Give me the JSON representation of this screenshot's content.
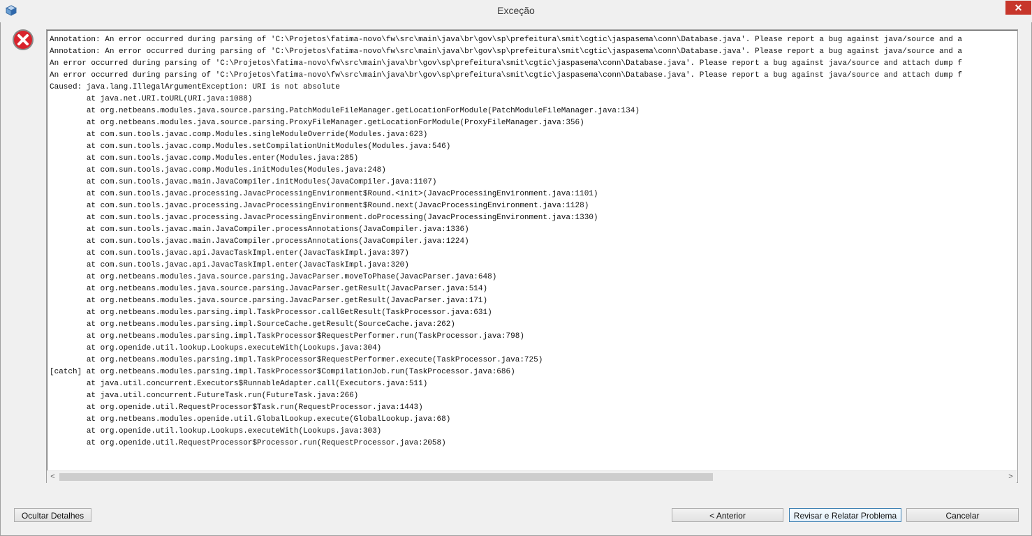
{
  "window": {
    "title": "Exceção",
    "close_label": "✕"
  },
  "trace_text": "Annotation: An error occurred during parsing of 'C:\\Projetos\\fatima-novo\\fw\\src\\main\\java\\br\\gov\\sp\\prefeitura\\smit\\cgtic\\jaspasema\\conn\\Database.java'. Please report a bug against java/source and a\nAnnotation: An error occurred during parsing of 'C:\\Projetos\\fatima-novo\\fw\\src\\main\\java\\br\\gov\\sp\\prefeitura\\smit\\cgtic\\jaspasema\\conn\\Database.java'. Please report a bug against java/source and a\nAn error occurred during parsing of 'C:\\Projetos\\fatima-novo\\fw\\src\\main\\java\\br\\gov\\sp\\prefeitura\\smit\\cgtic\\jaspasema\\conn\\Database.java'. Please report a bug against java/source and attach dump f\nAn error occurred during parsing of 'C:\\Projetos\\fatima-novo\\fw\\src\\main\\java\\br\\gov\\sp\\prefeitura\\smit\\cgtic\\jaspasema\\conn\\Database.java'. Please report a bug against java/source and attach dump f\nCaused: java.lang.IllegalArgumentException: URI is not absolute\n\tat java.net.URI.toURL(URI.java:1088)\n\tat org.netbeans.modules.java.source.parsing.PatchModuleFileManager.getLocationForModule(PatchModuleFileManager.java:134)\n\tat org.netbeans.modules.java.source.parsing.ProxyFileManager.getLocationForModule(ProxyFileManager.java:356)\n\tat com.sun.tools.javac.comp.Modules.singleModuleOverride(Modules.java:623)\n\tat com.sun.tools.javac.comp.Modules.setCompilationUnitModules(Modules.java:546)\n\tat com.sun.tools.javac.comp.Modules.enter(Modules.java:285)\n\tat com.sun.tools.javac.comp.Modules.initModules(Modules.java:248)\n\tat com.sun.tools.javac.main.JavaCompiler.initModules(JavaCompiler.java:1107)\n\tat com.sun.tools.javac.processing.JavacProcessingEnvironment$Round.<init>(JavacProcessingEnvironment.java:1101)\n\tat com.sun.tools.javac.processing.JavacProcessingEnvironment$Round.next(JavacProcessingEnvironment.java:1128)\n\tat com.sun.tools.javac.processing.JavacProcessingEnvironment.doProcessing(JavacProcessingEnvironment.java:1330)\n\tat com.sun.tools.javac.main.JavaCompiler.processAnnotations(JavaCompiler.java:1336)\n\tat com.sun.tools.javac.main.JavaCompiler.processAnnotations(JavaCompiler.java:1224)\n\tat com.sun.tools.javac.api.JavacTaskImpl.enter(JavacTaskImpl.java:397)\n\tat com.sun.tools.javac.api.JavacTaskImpl.enter(JavacTaskImpl.java:320)\n\tat org.netbeans.modules.java.source.parsing.JavacParser.moveToPhase(JavacParser.java:648)\n\tat org.netbeans.modules.java.source.parsing.JavacParser.getResult(JavacParser.java:514)\n\tat org.netbeans.modules.java.source.parsing.JavacParser.getResult(JavacParser.java:171)\n\tat org.netbeans.modules.parsing.impl.TaskProcessor.callGetResult(TaskProcessor.java:631)\n\tat org.netbeans.modules.parsing.impl.SourceCache.getResult(SourceCache.java:262)\n\tat org.netbeans.modules.parsing.impl.TaskProcessor$RequestPerformer.run(TaskProcessor.java:798)\n\tat org.openide.util.lookup.Lookups.executeWith(Lookups.java:304)\n\tat org.netbeans.modules.parsing.impl.TaskProcessor$RequestPerformer.execute(TaskProcessor.java:725)\n[catch] at org.netbeans.modules.parsing.impl.TaskProcessor$CompilationJob.run(TaskProcessor.java:686)\n\tat java.util.concurrent.Executors$RunnableAdapter.call(Executors.java:511)\n\tat java.util.concurrent.FutureTask.run(FutureTask.java:266)\n\tat org.openide.util.RequestProcessor$Task.run(RequestProcessor.java:1443)\n\tat org.netbeans.modules.openide.util.GlobalLookup.execute(GlobalLookup.java:68)\n\tat org.openide.util.lookup.Lookups.executeWith(Lookups.java:303)\n\tat org.openide.util.RequestProcessor$Processor.run(RequestProcessor.java:2058)",
  "scrollbar": {
    "left_arrow": "<",
    "right_arrow": ">"
  },
  "buttons": {
    "hide_details": "Ocultar Detalhes",
    "previous": "< Anterior",
    "review_report": "Revisar e Relatar Problema",
    "cancel": "Cancelar"
  },
  "icons": {
    "app": "netbeans-cube-icon",
    "error": "error-icon"
  },
  "colors": {
    "close_button": "#c7362b",
    "error_red": "#d9232d"
  }
}
